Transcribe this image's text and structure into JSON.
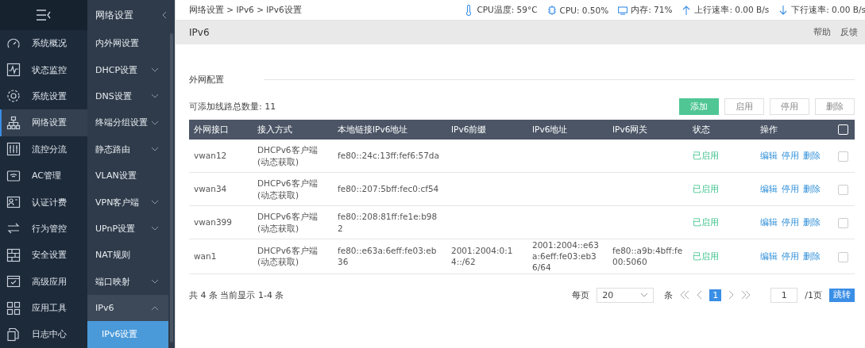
{
  "sidebar": {
    "items": [
      {
        "label": "系统概况",
        "selected": false
      },
      {
        "label": "状态监控",
        "selected": false
      },
      {
        "label": "系统设置",
        "selected": false
      },
      {
        "label": "网络设置",
        "selected": true
      },
      {
        "label": "流控分流",
        "selected": false
      },
      {
        "label": "AC管理",
        "selected": false
      },
      {
        "label": "认证计费",
        "selected": false
      },
      {
        "label": "行为管控",
        "selected": false
      },
      {
        "label": "安全设置",
        "selected": false
      },
      {
        "label": "高级应用",
        "selected": false
      },
      {
        "label": "应用工具",
        "selected": false
      },
      {
        "label": "日志中心",
        "selected": false
      }
    ]
  },
  "submenu": {
    "title": "网络设置",
    "items": [
      {
        "label": "内外网设置",
        "kind": "link",
        "selected": false
      },
      {
        "label": "DHCP设置",
        "kind": "group",
        "expanded": false
      },
      {
        "label": "DNS设置",
        "kind": "group",
        "expanded": false
      },
      {
        "label": "终端分组设置",
        "kind": "group",
        "expanded": false
      },
      {
        "label": "静态路由",
        "kind": "group",
        "expanded": false
      },
      {
        "label": "VLAN设置",
        "kind": "link",
        "selected": false
      },
      {
        "label": "VPN客户端",
        "kind": "group",
        "expanded": false
      },
      {
        "label": "UPnP设置",
        "kind": "group",
        "expanded": false
      },
      {
        "label": "NAT规则",
        "kind": "link",
        "selected": false
      },
      {
        "label": "端口映射",
        "kind": "group",
        "expanded": false
      },
      {
        "label": "IPv6",
        "kind": "group",
        "expanded": true,
        "children": [
          {
            "label": "IPv6设置",
            "selected": true
          }
        ]
      }
    ]
  },
  "breadcrumb": "网络设置 > IPv6 > IPv6设置",
  "status_bar": [
    {
      "kind": "temperature",
      "text": "CPU温度: 59°C"
    },
    {
      "kind": "cpu",
      "text": "CPU: 0.50%"
    },
    {
      "kind": "memory",
      "text": "内存: 71%"
    },
    {
      "kind": "upload",
      "text": "上行速率: 0.00 B/s"
    },
    {
      "kind": "download",
      "text": "下行速率: 0.00 B/s"
    }
  ],
  "page": {
    "title": "IPv6",
    "links": [
      "帮助",
      "反馈"
    ]
  },
  "section_title": "外网配置",
  "line_count": "可添加线路总数量: 11",
  "buttons": [
    {
      "label": "添加",
      "kind": "primary"
    },
    {
      "label": "启用",
      "kind": "default"
    },
    {
      "label": "停用",
      "kind": "default"
    },
    {
      "label": "删除",
      "kind": "default"
    }
  ],
  "table": {
    "columns": [
      "外网接口",
      "接入方式",
      "本地链接IPv6地址",
      "IPv6前缀",
      "IPv6地址",
      "IPv6网关",
      "状态",
      "操作"
    ],
    "header_checked": false,
    "rows": [
      {
        "interface": "vwan12",
        "access": "DHCPv6客户端(动态获取)",
        "link_local": "fe80::24c:13ff:fef6:57da",
        "status": "已启用",
        "actions": [
          "编辑",
          "停用",
          "删除"
        ],
        "checked": false
      },
      {
        "interface": "vwan34",
        "access": "DHCPv6客户端(动态获取)",
        "link_local": "fe80::207:5bff:fec0:cf54",
        "status": "已启用",
        "actions": [
          "编辑",
          "停用",
          "删除"
        ],
        "checked": false
      },
      {
        "interface": "vwan399",
        "access": "DHCPv6客户端(动态获取)",
        "link_local": "fe80::208:81ff:fe1e:b982",
        "status": "已启用",
        "actions": [
          "编辑",
          "停用",
          "删除"
        ],
        "checked": false
      },
      {
        "interface": "wan1",
        "access": "DHCPv6客户端(动态获取)",
        "link_local": "fe80::e63a:6eff:fe03:eb36",
        "prefix": "2001:2004:0:14::/62",
        "address": "2001:2004::e63a:6eff:fe03:eb36/64",
        "gateway": "fe80::a9b:4bff:fe00:5060",
        "status": "已启用",
        "actions": [
          "编辑",
          "停用",
          "删除"
        ],
        "checked": false
      }
    ]
  },
  "pagination": {
    "summary": "共 4 条 当前显示 1-4 条",
    "per_page_label": "每页",
    "per_page": "20",
    "per_page_unit": "条",
    "pages": [
      {
        "label": "1",
        "selected": true
      }
    ],
    "page_input": "1",
    "total": "/1页",
    "go": "跳转"
  }
}
